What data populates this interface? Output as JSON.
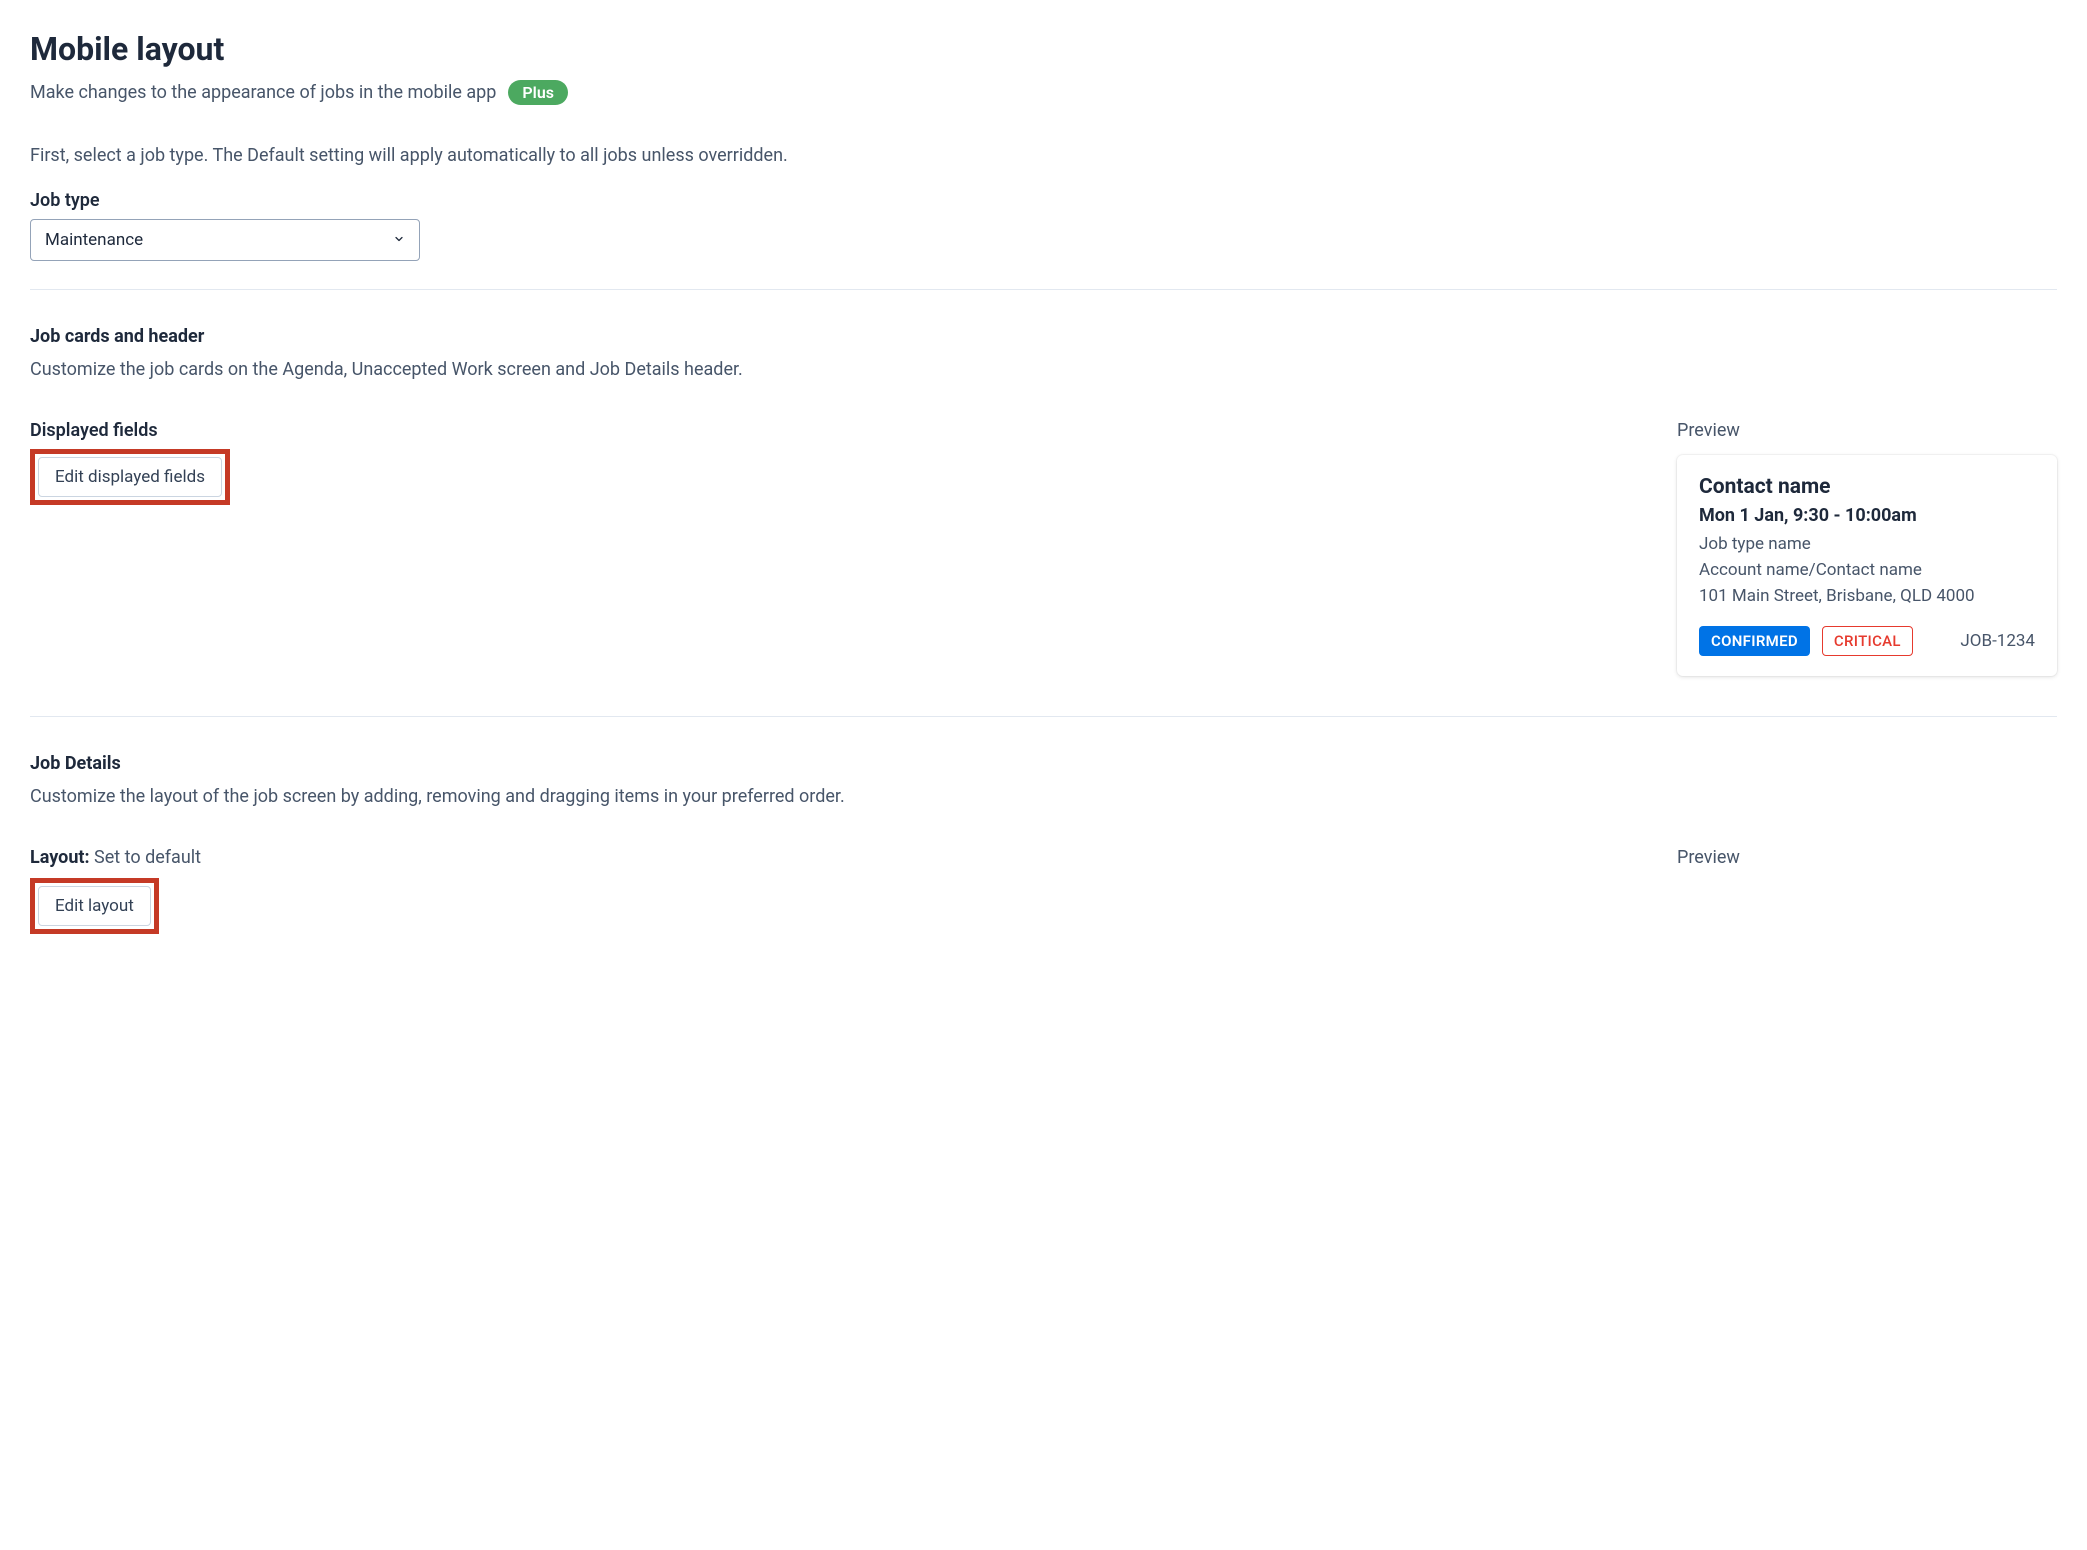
{
  "header": {
    "title": "Mobile layout",
    "subtitle": "Make changes to the appearance of jobs in the mobile app",
    "badge": "Plus"
  },
  "intro": "First, select a job type. The Default setting will apply automatically to all jobs unless overridden.",
  "job_type": {
    "label": "Job type",
    "selected": "Maintenance"
  },
  "cards_section": {
    "title": "Job cards and header",
    "description": "Customize the job cards on the Agenda, Unaccepted Work screen and Job Details header.",
    "displayed_fields_label": "Displayed fields",
    "edit_button": "Edit displayed fields",
    "preview_label": "Preview"
  },
  "preview_card": {
    "contact": "Contact name",
    "time": "Mon 1 Jan, 9:30 - 10:00am",
    "job_type": "Job type name",
    "account_contact": "Account name/Contact name",
    "address": "101 Main Street, Brisbane, QLD 4000",
    "status_badge": "CONFIRMED",
    "priority_badge": "CRITICAL",
    "job_id": "JOB-1234"
  },
  "details_section": {
    "title": "Job Details",
    "description": "Customize the layout of the job screen by adding, removing and dragging items in your preferred order.",
    "layout_label": "Layout:",
    "layout_value": "Set to default",
    "edit_button": "Edit layout",
    "preview_label": "Preview"
  },
  "colors": {
    "highlight_border": "#c53a26",
    "badge_plus": "#4ca960",
    "badge_confirmed": "#0073e6",
    "badge_critical": "#e63a2e"
  }
}
